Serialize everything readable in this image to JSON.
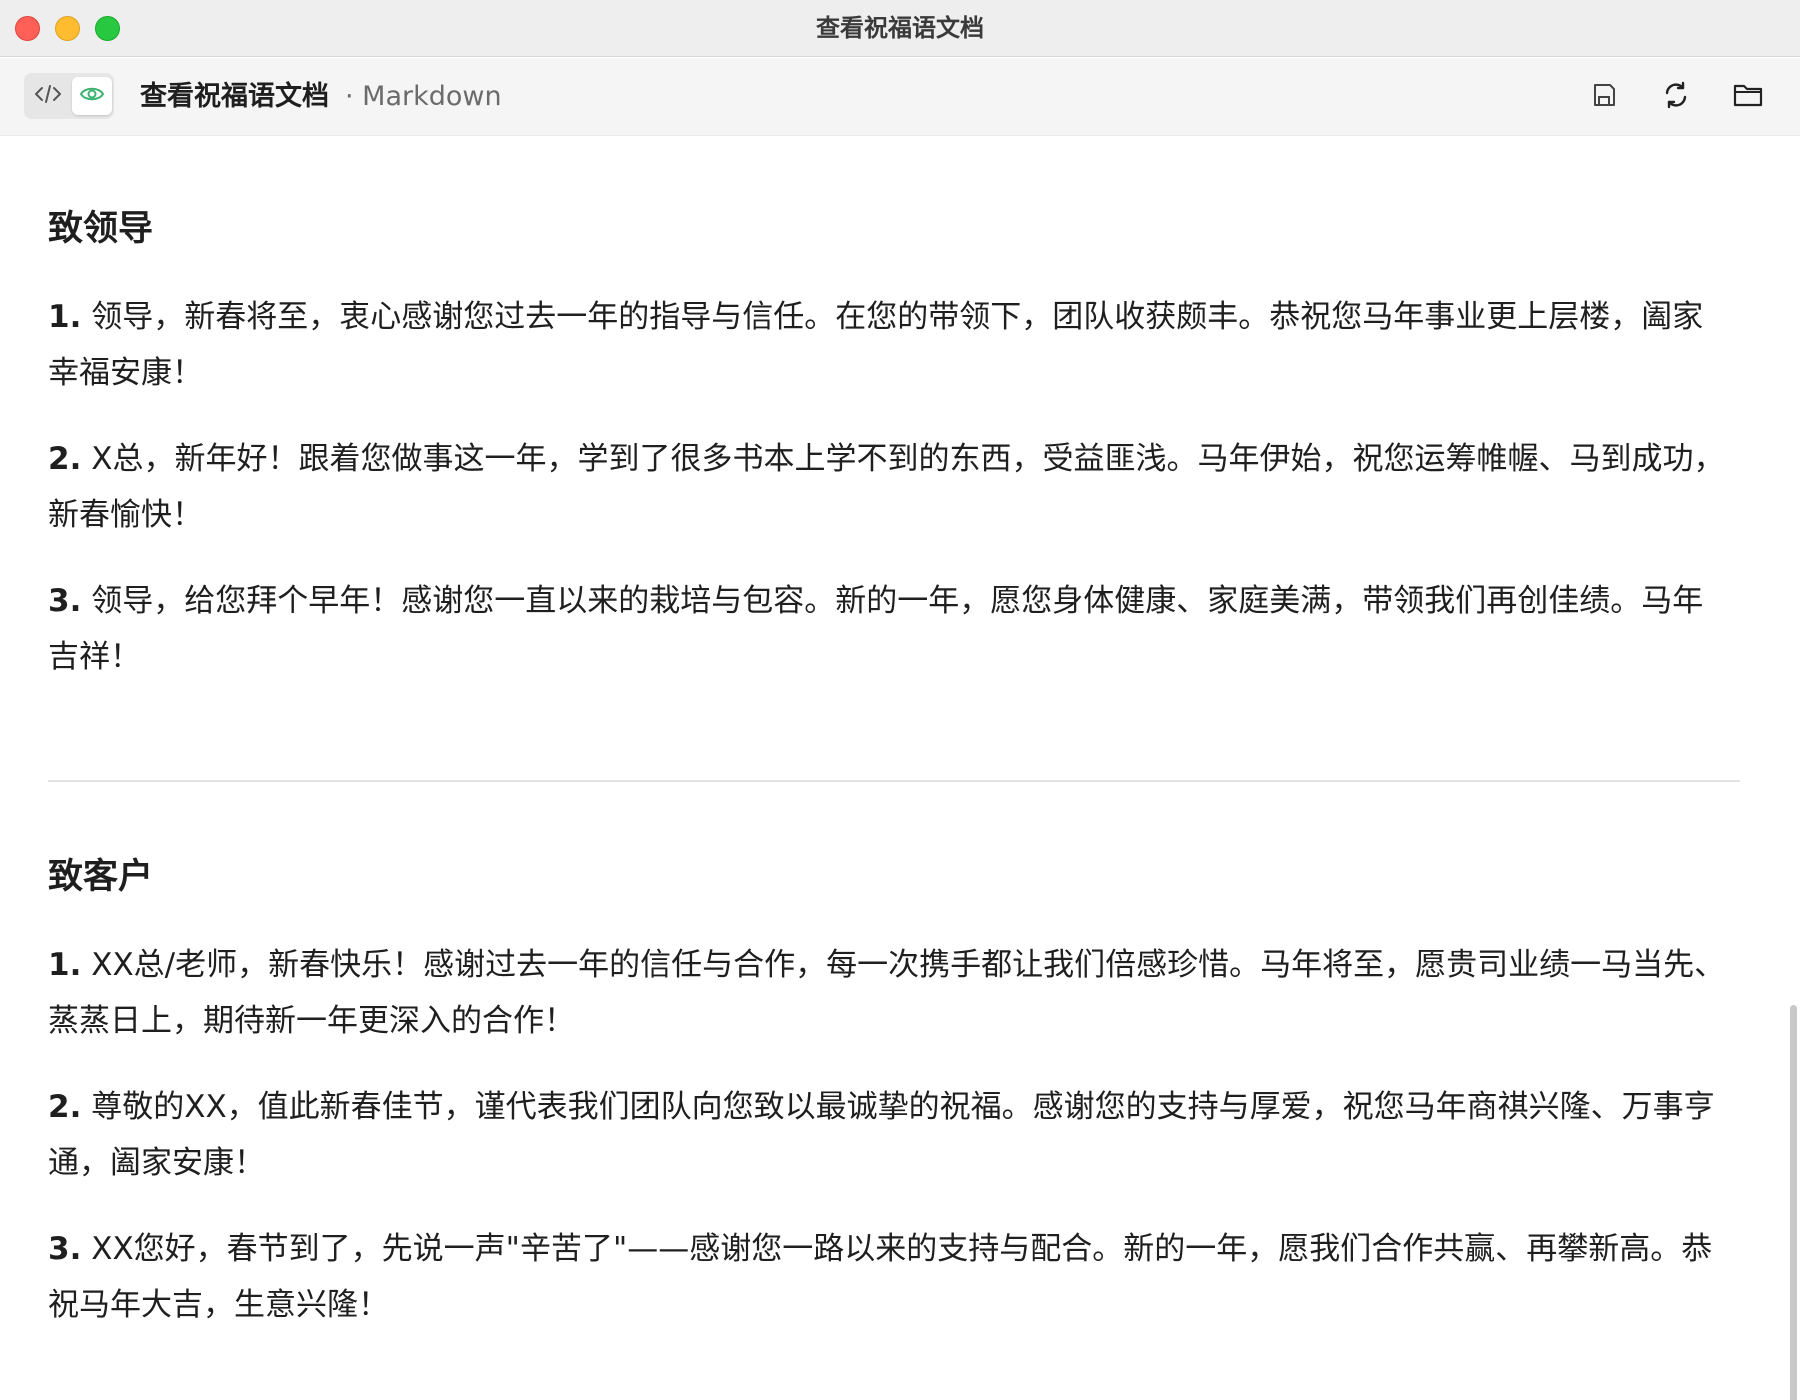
{
  "window": {
    "title": "查看祝福语文档"
  },
  "toolbar": {
    "doc_name": "查看祝福语文档",
    "doc_type": "· Markdown"
  },
  "icons": {
    "code": "code-icon",
    "preview": "eye-icon",
    "save": "save-icon",
    "refresh": "refresh-icon",
    "folder": "folder-icon"
  },
  "colors": {
    "preview_accent": "#3cb371",
    "close": "#fe5f57",
    "minimize": "#febc2e",
    "zoom": "#28c840"
  },
  "sections": [
    {
      "heading": "致领导",
      "items": [
        {
          "num": "1.",
          "text": " 领导，新春将至，衷心感谢您过去一年的指导与信任。在您的带领下，团队收获颇丰。恭祝您马年事业更上层楼，阖家幸福安康！"
        },
        {
          "num": "2.",
          "text": " X总，新年好！跟着您做事这一年，学到了很多书本上学不到的东西，受益匪浅。马年伊始，祝您运筹帷幄、马到成功，新春愉快！"
        },
        {
          "num": "3.",
          "text": " 领导，给您拜个早年！感谢您一直以来的栽培与包容。新的一年，愿您身体健康、家庭美满，带领我们再创佳绩。马年吉祥！"
        }
      ]
    },
    {
      "heading": "致客户",
      "items": [
        {
          "num": "1.",
          "text": " XX总/老师，新春快乐！感谢过去一年的信任与合作，每一次携手都让我们倍感珍惜。马年将至，愿贵司业绩一马当先、蒸蒸日上，期待新一年更深入的合作！"
        },
        {
          "num": "2.",
          "text": " 尊敬的XX，值此新春佳节，谨代表我们团队向您致以最诚挚的祝福。感谢您的支持与厚爱，祝您马年商祺兴隆、万事亨通，阖家安康！"
        },
        {
          "num": "3.",
          "text": " XX您好，春节到了，先说一声\"辛苦了\"——感谢您一路以来的支持与配合。新的一年，愿我们合作共赢、再攀新高。恭祝马年大吉，生意兴隆！"
        }
      ]
    }
  ]
}
